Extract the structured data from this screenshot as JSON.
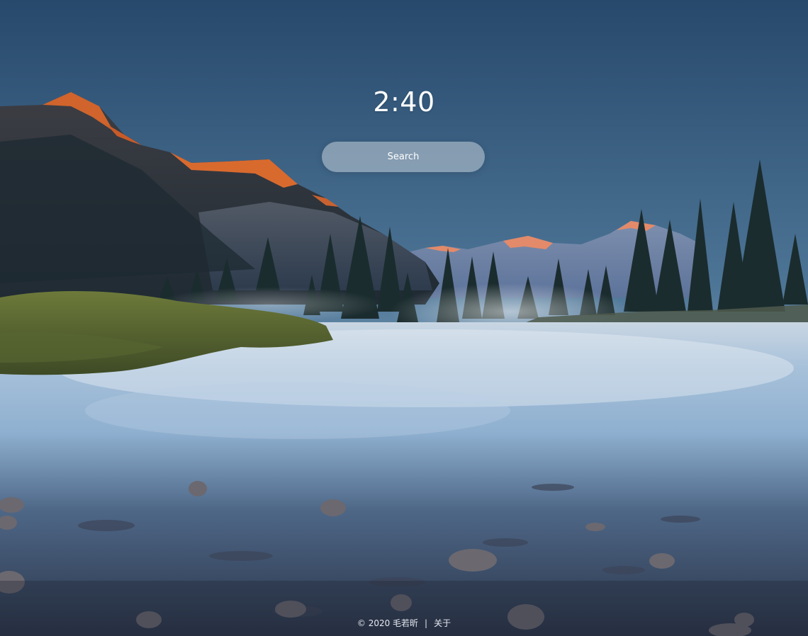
{
  "clock": {
    "time": "2:40"
  },
  "search": {
    "placeholder": "Search"
  },
  "footer": {
    "copyright": "© 2020 毛若昕",
    "separator": "|",
    "about": "关于"
  },
  "background": {
    "subject": "mountain-river-landscape"
  },
  "colors": {
    "sky_top": "#2a4a6b",
    "sky_horizon": "#b9cde0",
    "water": "#8fb3d6",
    "peak_glow": "#e0672a"
  }
}
